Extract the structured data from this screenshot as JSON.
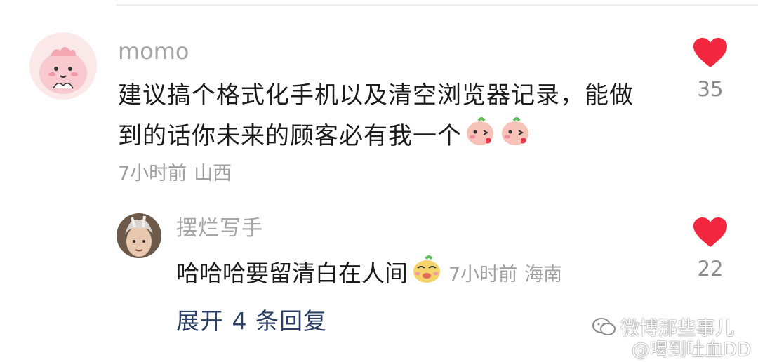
{
  "comment": {
    "username": "momo",
    "text": "建议搞个格式化手机以及清空浏览器记录，能做到的话你未来的顾客必有我一个",
    "emojis": [
      "kiss-emoji",
      "kiss-emoji"
    ],
    "time": "7小时前",
    "location": "山西",
    "likes": "35"
  },
  "reply": {
    "username": "摆烂写手",
    "text": "哈哈哈要留清白在人间",
    "emoji": "smirk-emoji",
    "time": "7小时前",
    "location": "海南",
    "likes": "22"
  },
  "expand_label": "展开 4 条回复",
  "watermark": {
    "account": "微博那些事儿",
    "user": "@喝到吐血DD"
  },
  "colors": {
    "like_red": "#f2273f",
    "link_blue": "#2b3f66",
    "meta_gray": "#9f9f9f"
  }
}
